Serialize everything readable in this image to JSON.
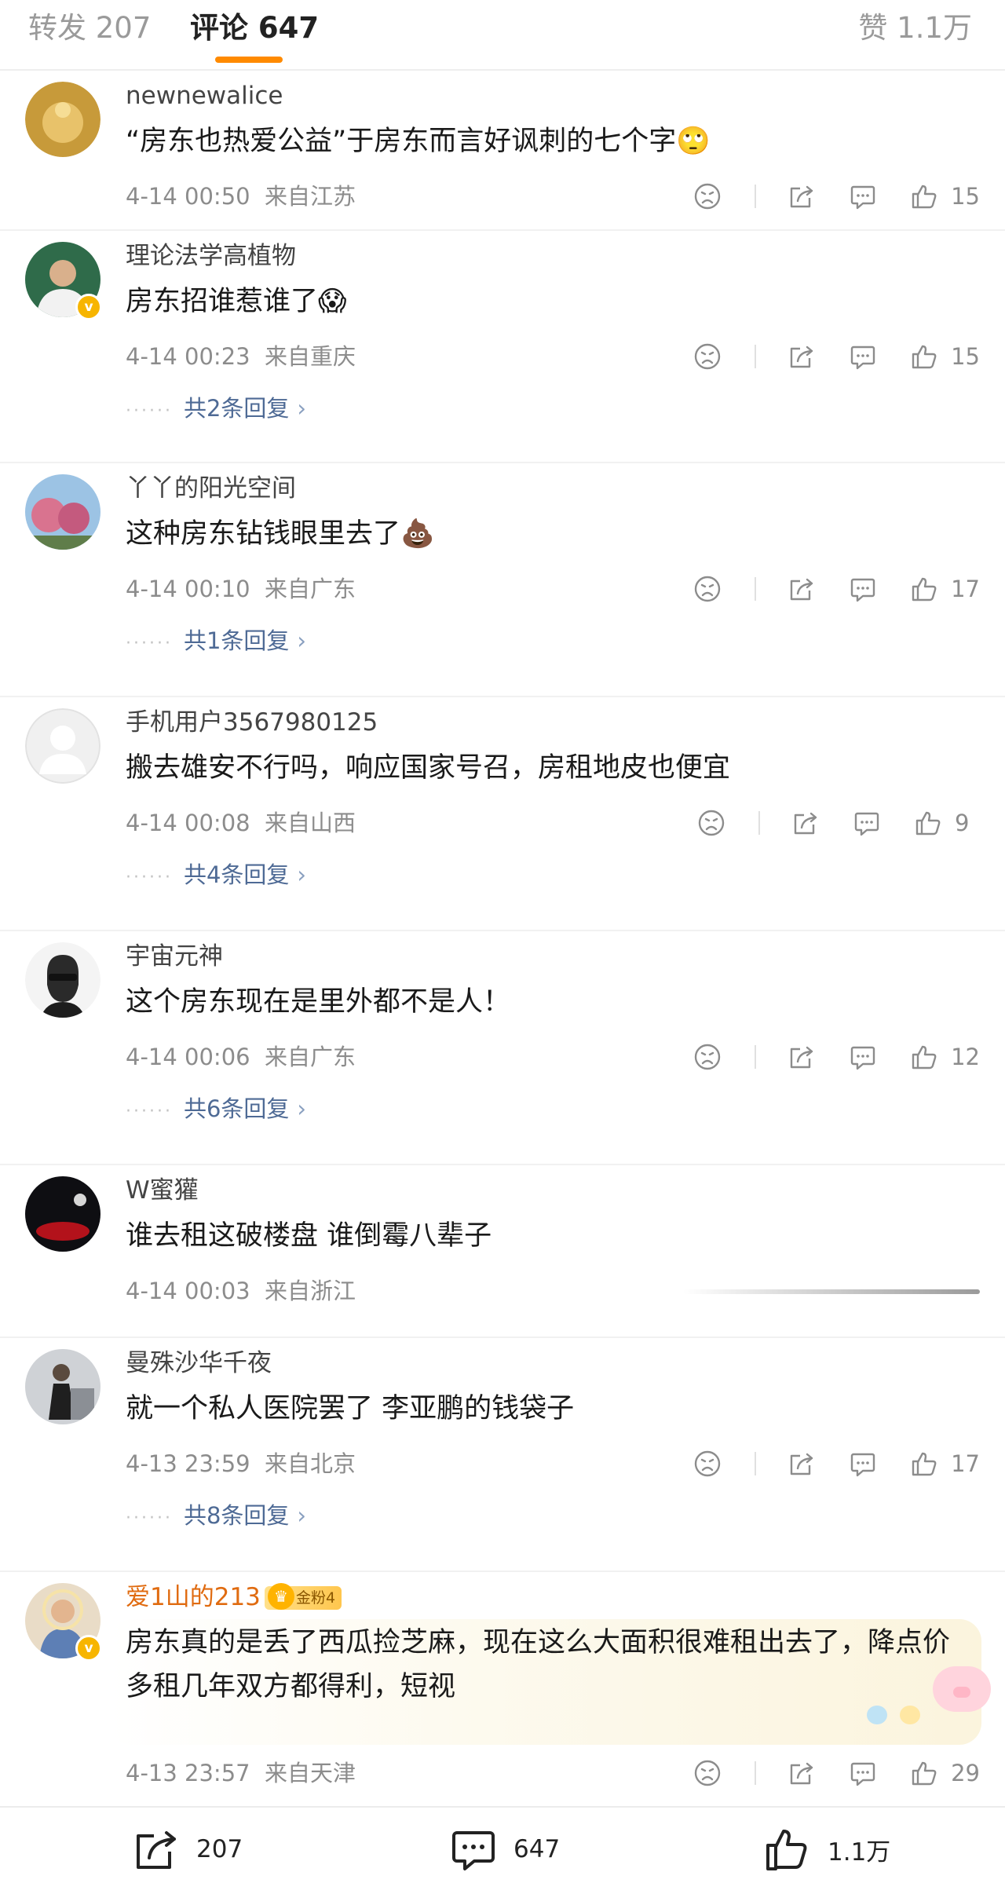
{
  "tabs": {
    "repost": "转发 207",
    "comments": "评论 647",
    "likes": "赞 1.1万"
  },
  "comments": [
    {
      "username": "newnewalice",
      "text": "“房东也热爱公益”于房东而言好讽刺的七个字🙄",
      "time": "4-14 00:50",
      "location": "来自江苏",
      "likes": "15"
    },
    {
      "username": "理论法学高植物",
      "text": "房东招谁惹谁了😱",
      "time": "4-14 00:23",
      "location": "来自重庆",
      "likes": "15",
      "replies": "共2条回复"
    },
    {
      "username": "丫丫的阳光空间",
      "text": "这种房东钻钱眼里去了💩",
      "time": "4-14 00:10",
      "location": "来自广东",
      "likes": "17",
      "replies": "共1条回复"
    },
    {
      "username": "手机用户3567980125",
      "text": "搬去雄安不行吗，响应国家号召，房租地皮也便宜",
      "time": "4-14 00:08",
      "location": "来自山西",
      "likes": "9",
      "replies": "共4条回复"
    },
    {
      "username": "宇宙元神",
      "text": "这个房东现在是里外都不是人！",
      "time": "4-14 00:06",
      "location": "来自广东",
      "likes": "12",
      "replies": "共6条回复"
    },
    {
      "username": "W蜜獾",
      "text": "谁去租这破楼盘 谁倒霉八辈子",
      "time": "4-14 00:03",
      "location": "来自浙江"
    },
    {
      "username": "曼殊沙华千夜",
      "text": "就一个私人医院罢了 李亚鹏的钱袋子",
      "time": "4-13 23:59",
      "location": "来自北京",
      "likes": "17",
      "replies": "共8条回复"
    },
    {
      "username": "爱1山的213",
      "fan_badge": "金粉4",
      "text": "房东真的是丢了西瓜捡芝麻，现在这么大面积很难租出去了，降点价多租几年双方都得利，短视",
      "time": "4-13 23:57",
      "location": "来自天津",
      "likes": "29"
    }
  ],
  "bottom_bar": {
    "repost_count": "207",
    "comment_count": "647",
    "like_count": "1.1万"
  },
  "icons": [
    "dislike-icon",
    "share-icon",
    "comment-icon",
    "like-icon",
    "chevron-right-icon",
    "verified-icon",
    "crown-icon"
  ],
  "colors": {
    "accent": "#ff8a00",
    "link": "#4e6a95",
    "meta": "#8c8c8c",
    "verified": "#f7b500",
    "gold_name": "#e06b10"
  }
}
